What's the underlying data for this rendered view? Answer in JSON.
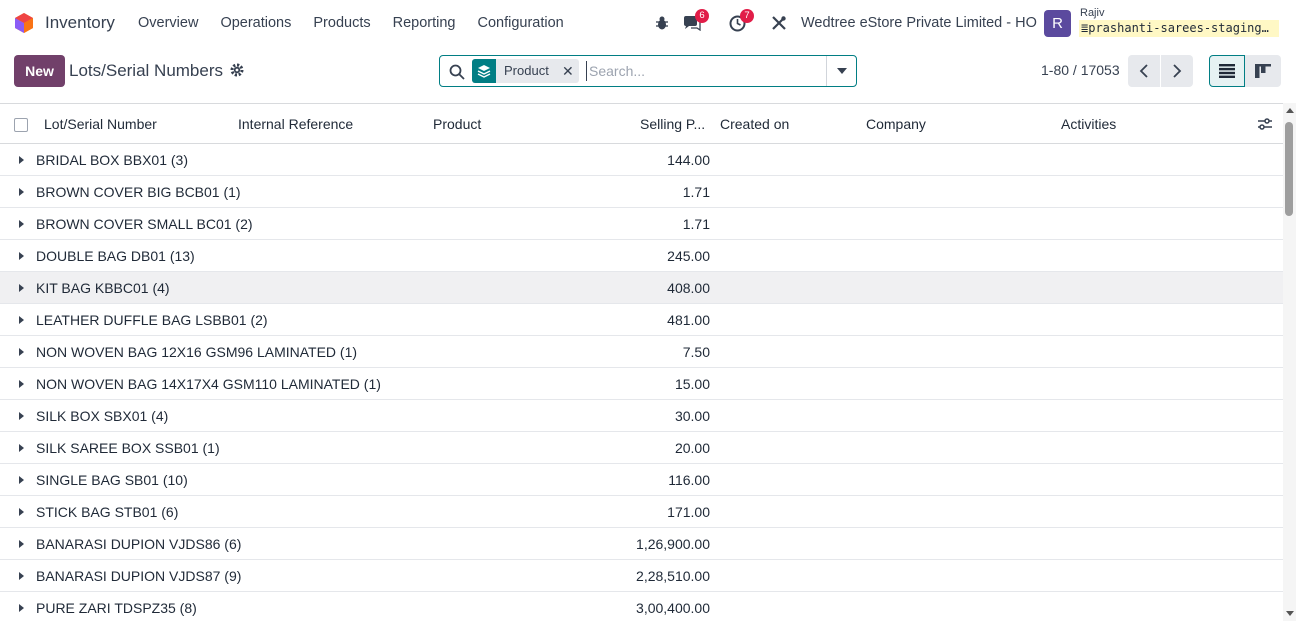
{
  "navbar": {
    "app_name": "Inventory",
    "menu": [
      "Overview",
      "Operations",
      "Products",
      "Reporting",
      "Configuration"
    ],
    "chat_badge": "6",
    "activity_badge": "7",
    "company": "Wedtree eStore Private Limited - HO",
    "avatar_letter": "R",
    "user_name": "Rajiv",
    "database": "prashanti-sarees-staging…",
    "accent_color": "#71406a"
  },
  "control_panel": {
    "new_label": "New",
    "title": "Lots/Serial Numbers",
    "facet_label": "Product",
    "search_placeholder": "Search...",
    "pager": "1-80 / 17053"
  },
  "table": {
    "columns": [
      "Lot/Serial Number",
      "Internal Reference",
      "Product",
      "Selling P...",
      "Created on",
      "Company",
      "Activities"
    ],
    "groups": [
      {
        "name": "BRIDAL BOX BBX01 (3)",
        "price": "144.00"
      },
      {
        "name": "BROWN COVER BIG BCB01 (1)",
        "price": "1.71"
      },
      {
        "name": "BROWN COVER SMALL BC01 (2)",
        "price": "1.71"
      },
      {
        "name": "DOUBLE BAG DB01 (13)",
        "price": "245.00"
      },
      {
        "name": "KIT BAG KBBC01 (4)",
        "price": "408.00"
      },
      {
        "name": "LEATHER DUFFLE BAG LSBB01 (2)",
        "price": "481.00"
      },
      {
        "name": "NON WOVEN BAG 12X16 GSM96 LAMINATED (1)",
        "price": "7.50"
      },
      {
        "name": "NON WOVEN BAG 14X17X4 GSM110 LAMINATED (1)",
        "price": "15.00"
      },
      {
        "name": "SILK BOX SBX01 (4)",
        "price": "30.00"
      },
      {
        "name": "SILK SAREE BOX SSB01 (1)",
        "price": "20.00"
      },
      {
        "name": "SINGLE BAG SB01 (10)",
        "price": "116.00"
      },
      {
        "name": "STICK BAG STB01 (6)",
        "price": "171.00"
      },
      {
        "name": "BANARASI DUPION VJDS86 (6)",
        "price": "1,26,900.00"
      },
      {
        "name": "BANARASI DUPION VJDS87 (9)",
        "price": "2,28,510.00"
      },
      {
        "name": "PURE ZARI TDSPZ35 (8)",
        "price": "3,00,400.00"
      }
    ]
  }
}
